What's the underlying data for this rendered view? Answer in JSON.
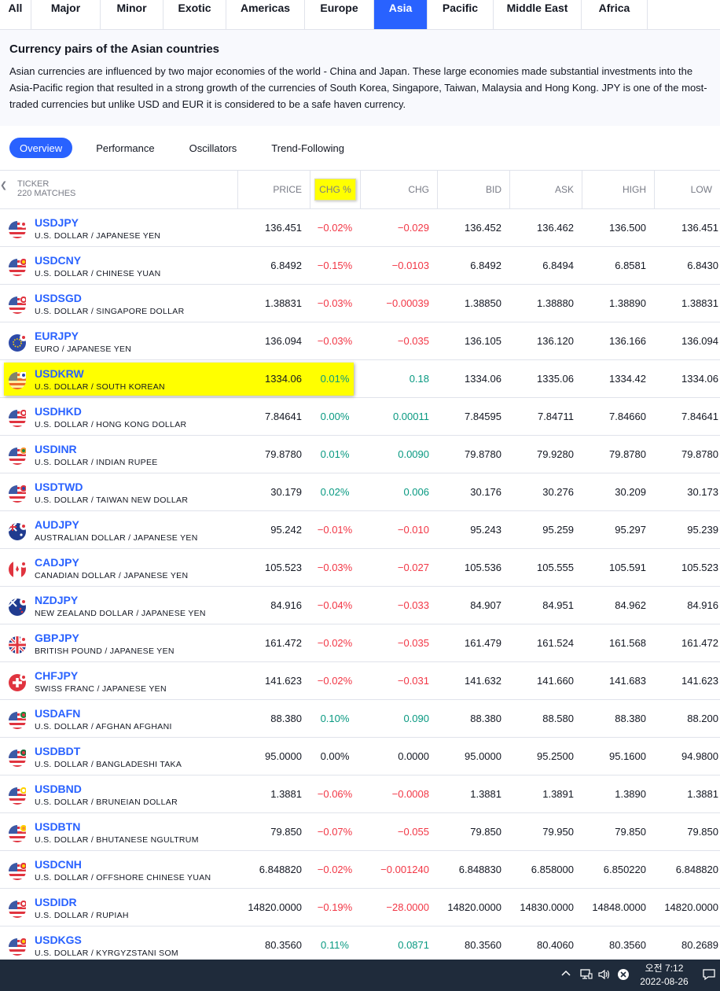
{
  "region_tabs": [
    "All",
    "Major",
    "Minor",
    "Exotic",
    "Americas",
    "Europe",
    "Asia",
    "Pacific",
    "Middle East",
    "Africa"
  ],
  "active_region": "Asia",
  "intro": {
    "title": "Currency pairs of the Asian countries",
    "text": "Asian currencies are influenced by two major economies of the world - China and Japan. These large economies made substantial investments into the Asia-Pacific region that resulted in a strong growth of the currencies of South Korea, Singapore, Taiwan, Malaysia and Hong Kong. JPY is one of the most-traded currencies but unlike USD and EUR it is considered to be a safe haven currency."
  },
  "view_tabs": [
    "Overview",
    "Performance",
    "Oscillators",
    "Trend-Following"
  ],
  "active_view": "Overview",
  "table": {
    "ticker_label": "TICKER",
    "matches": "220 MATCHES",
    "columns": [
      "PRICE",
      "CHG %",
      "CHG",
      "BID",
      "ASK",
      "HIGH",
      "LOW"
    ],
    "rows": [
      {
        "symbol": "USDJPY",
        "desc": "U.S. DOLLAR / JAPANESE YEN",
        "flag": "us-jp-flag",
        "price": "136.451",
        "chg_pct": "−0.02%",
        "chg": "−0.029",
        "bid": "136.452",
        "ask": "136.462",
        "high": "136.500",
        "low": "136.451",
        "dir": "neg"
      },
      {
        "symbol": "USDCNY",
        "desc": "U.S. DOLLAR / CHINESE YUAN",
        "flag": "us-cn-flag",
        "price": "6.8492",
        "chg_pct": "−0.15%",
        "chg": "−0.0103",
        "bid": "6.8492",
        "ask": "6.8494",
        "high": "6.8581",
        "low": "6.8430",
        "dir": "neg"
      },
      {
        "symbol": "USDSGD",
        "desc": "U.S. DOLLAR / SINGAPORE DOLLAR",
        "flag": "us-sg-flag",
        "price": "1.38831",
        "chg_pct": "−0.03%",
        "chg": "−0.00039",
        "bid": "1.38850",
        "ask": "1.38880",
        "high": "1.38890",
        "low": "1.38831",
        "dir": "neg"
      },
      {
        "symbol": "EURJPY",
        "desc": "EURO / JAPANESE YEN",
        "flag": "eu-jp-flag",
        "price": "136.094",
        "chg_pct": "−0.03%",
        "chg": "−0.035",
        "bid": "136.105",
        "ask": "136.120",
        "high": "136.166",
        "low": "136.094",
        "dir": "neg"
      },
      {
        "symbol": "USDKRW",
        "desc": "U.S. DOLLAR / SOUTH KOREAN",
        "flag": "us-kr-flag",
        "price": "1334.06",
        "chg_pct": "0.01%",
        "chg": "0.18",
        "bid": "1334.06",
        "ask": "1335.06",
        "high": "1334.42",
        "low": "1334.06",
        "dir": "pos",
        "highlight": true
      },
      {
        "symbol": "USDHKD",
        "desc": "U.S. DOLLAR / HONG KONG DOLLAR",
        "flag": "us-hk-flag",
        "price": "7.84641",
        "chg_pct": "0.00%",
        "chg": "0.00011",
        "bid": "7.84595",
        "ask": "7.84711",
        "high": "7.84660",
        "low": "7.84641",
        "dir": "pos"
      },
      {
        "symbol": "USDINR",
        "desc": "U.S. DOLLAR / INDIAN RUPEE",
        "flag": "us-in-flag",
        "price": "79.8780",
        "chg_pct": "0.01%",
        "chg": "0.0090",
        "bid": "79.8780",
        "ask": "79.9280",
        "high": "79.8780",
        "low": "79.8780",
        "dir": "pos"
      },
      {
        "symbol": "USDTWD",
        "desc": "U.S. DOLLAR / TAIWAN NEW DOLLAR",
        "flag": "us-tw-flag",
        "price": "30.179",
        "chg_pct": "0.02%",
        "chg": "0.006",
        "bid": "30.176",
        "ask": "30.276",
        "high": "30.209",
        "low": "30.173",
        "dir": "pos"
      },
      {
        "symbol": "AUDJPY",
        "desc": "AUSTRALIAN DOLLAR / JAPANESE YEN",
        "flag": "au-jp-flag",
        "price": "95.242",
        "chg_pct": "−0.01%",
        "chg": "−0.010",
        "bid": "95.243",
        "ask": "95.259",
        "high": "95.297",
        "low": "95.239",
        "dir": "neg"
      },
      {
        "symbol": "CADJPY",
        "desc": "CANADIAN DOLLAR / JAPANESE YEN",
        "flag": "ca-jp-flag",
        "price": "105.523",
        "chg_pct": "−0.03%",
        "chg": "−0.027",
        "bid": "105.536",
        "ask": "105.555",
        "high": "105.591",
        "low": "105.523",
        "dir": "neg"
      },
      {
        "symbol": "NZDJPY",
        "desc": "NEW ZEALAND DOLLAR / JAPANESE YEN",
        "flag": "nz-jp-flag",
        "price": "84.916",
        "chg_pct": "−0.04%",
        "chg": "−0.033",
        "bid": "84.907",
        "ask": "84.951",
        "high": "84.962",
        "low": "84.916",
        "dir": "neg"
      },
      {
        "symbol": "GBPJPY",
        "desc": "BRITISH POUND / JAPANESE YEN",
        "flag": "gb-jp-flag",
        "price": "161.472",
        "chg_pct": "−0.02%",
        "chg": "−0.035",
        "bid": "161.479",
        "ask": "161.524",
        "high": "161.568",
        "low": "161.472",
        "dir": "neg"
      },
      {
        "symbol": "CHFJPY",
        "desc": "SWISS FRANC / JAPANESE YEN",
        "flag": "ch-jp-flag",
        "price": "141.623",
        "chg_pct": "−0.02%",
        "chg": "−0.031",
        "bid": "141.632",
        "ask": "141.660",
        "high": "141.683",
        "low": "141.623",
        "dir": "neg"
      },
      {
        "symbol": "USDAFN",
        "desc": "U.S. DOLLAR / AFGHAN AFGHANI",
        "flag": "us-af-flag",
        "price": "88.380",
        "chg_pct": "0.10%",
        "chg": "0.090",
        "bid": "88.380",
        "ask": "88.580",
        "high": "88.380",
        "low": "88.200",
        "dir": "pos"
      },
      {
        "symbol": "USDBDT",
        "desc": "U.S. DOLLAR / BANGLADESHI TAKA",
        "flag": "us-bd-flag",
        "price": "95.0000",
        "chg_pct": "0.00%",
        "chg": "0.0000",
        "bid": "95.0000",
        "ask": "95.2500",
        "high": "95.1600",
        "low": "94.9800",
        "dir": "neu"
      },
      {
        "symbol": "USDBND",
        "desc": "U.S. DOLLAR / BRUNEIAN DOLLAR",
        "flag": "us-bn-flag",
        "price": "1.3881",
        "chg_pct": "−0.06%",
        "chg": "−0.0008",
        "bid": "1.3881",
        "ask": "1.3891",
        "high": "1.3890",
        "low": "1.3881",
        "dir": "neg"
      },
      {
        "symbol": "USDBTN",
        "desc": "U.S. DOLLAR / BHUTANESE NGULTRUM",
        "flag": "us-bt-flag",
        "price": "79.850",
        "chg_pct": "−0.07%",
        "chg": "−0.055",
        "bid": "79.850",
        "ask": "79.950",
        "high": "79.850",
        "low": "79.850",
        "dir": "neg"
      },
      {
        "symbol": "USDCNH",
        "desc": "U.S. DOLLAR / OFFSHORE CHINESE YUAN",
        "flag": "us-cn-flag",
        "price": "6.848820",
        "chg_pct": "−0.02%",
        "chg": "−0.001240",
        "bid": "6.848830",
        "ask": "6.858000",
        "high": "6.850220",
        "low": "6.848820",
        "dir": "neg"
      },
      {
        "symbol": "USDIDR",
        "desc": "U.S. DOLLAR / RUPIAH",
        "flag": "us-id-flag",
        "price": "14820.0000",
        "chg_pct": "−0.19%",
        "chg": "−28.0000",
        "bid": "14820.0000",
        "ask": "14830.0000",
        "high": "14848.0000",
        "low": "14820.0000",
        "dir": "neg"
      },
      {
        "symbol": "USDKGS",
        "desc": "U.S. DOLLAR / KYRGYZSTANI SOM",
        "flag": "us-kg-flag",
        "price": "80.3560",
        "chg_pct": "0.11%",
        "chg": "0.0871",
        "bid": "80.3560",
        "ask": "80.4060",
        "high": "80.3560",
        "low": "80.2689",
        "dir": "pos"
      }
    ]
  },
  "taskbar": {
    "time": "오전 7:12",
    "date": "2022-08-26"
  },
  "colors": {
    "accent": "#2962ff",
    "negative": "#f23645",
    "positive": "#089981",
    "highlight": "#ffff00",
    "taskbar": "#1f2b3b"
  }
}
